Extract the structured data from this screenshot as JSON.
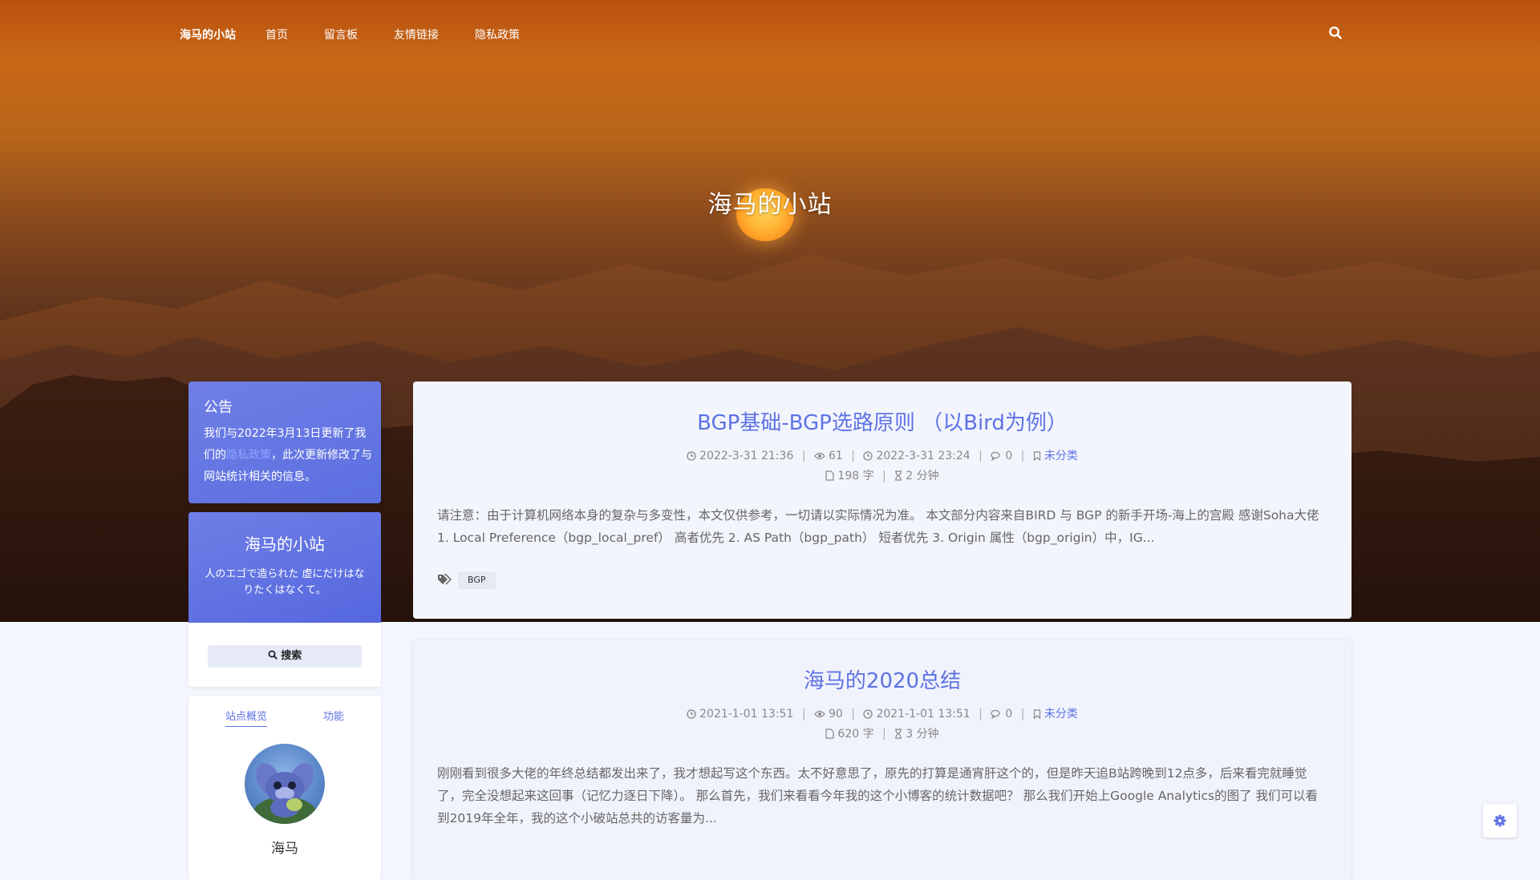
{
  "nav": {
    "brand": "海马的小站",
    "items": [
      "首页",
      "留言板",
      "友情链接",
      "隐私政策"
    ]
  },
  "hero": {
    "title": "海马的小站"
  },
  "notice": {
    "title": "公告",
    "text_before": "我们与2022年3月13日更新了我们的",
    "link": "隐私政策",
    "text_after": "，此次更新修改了与网站统计相关的信息。"
  },
  "site_card": {
    "name": "海马的小站",
    "motto": "人のエゴで造られた 虚にだけはなりたくはなくて。",
    "search_label": "搜索"
  },
  "stats_card": {
    "tabs": [
      "站点概览",
      "功能"
    ],
    "author": "海马"
  },
  "posts": [
    {
      "title": "BGP基础-BGP选路原则 （以Bird为例）",
      "published": "2022-3-31 21:36",
      "views": "61",
      "updated": "2022-3-31 23:24",
      "comments": "0",
      "category": "未分类",
      "words": "198 字",
      "read_time": "2 分钟",
      "excerpt": "请注意：由于计算机网络本身的复杂与多变性，本文仅供参考，一切请以实际情况为准。 本文部分内容来自BIRD 与 BGP 的新手开场-海上的宫殿 感谢Soha大佬 1. Local Preference（bgp_local_pref） 高者优先 2. AS Path（bgp_path） 短者优先 3. Origin 属性（bgp_origin）中，IG...",
      "tags": [
        "BGP"
      ]
    },
    {
      "title": "海马的2020总结",
      "published": "2021-1-01 13:51",
      "views": "90",
      "updated": "2021-1-01 13:51",
      "comments": "0",
      "category": "未分类",
      "words": "620 字",
      "read_time": "3 分钟",
      "excerpt": "刚刚看到很多大佬的年终总结都发出来了，我才想起写这个东西。太不好意思了，原先的打算是通宵肝这个的，但是昨天追B站跨晚到12点多，后来看完就睡觉了，完全没想起来这回事（记忆力逐日下降）。 那么首先，我们来看看今年我的这个小博客的统计数据吧？ 那么我们开始上Google Analytics的图了 我们可以看到2019年全年，我的这个小破站总共的访客量为..."
    }
  ],
  "colors": {
    "accent": "#5e72e4",
    "hero_top": "#c96716",
    "hero_bottom": "#2a140a",
    "page_bg": "#f4f6fd"
  },
  "icons": [
    "search-icon",
    "clock-icon",
    "eye-icon",
    "comment-icon",
    "bookmark-icon",
    "file-icon",
    "hourglass-icon",
    "tags-icon",
    "gear-icon"
  ]
}
